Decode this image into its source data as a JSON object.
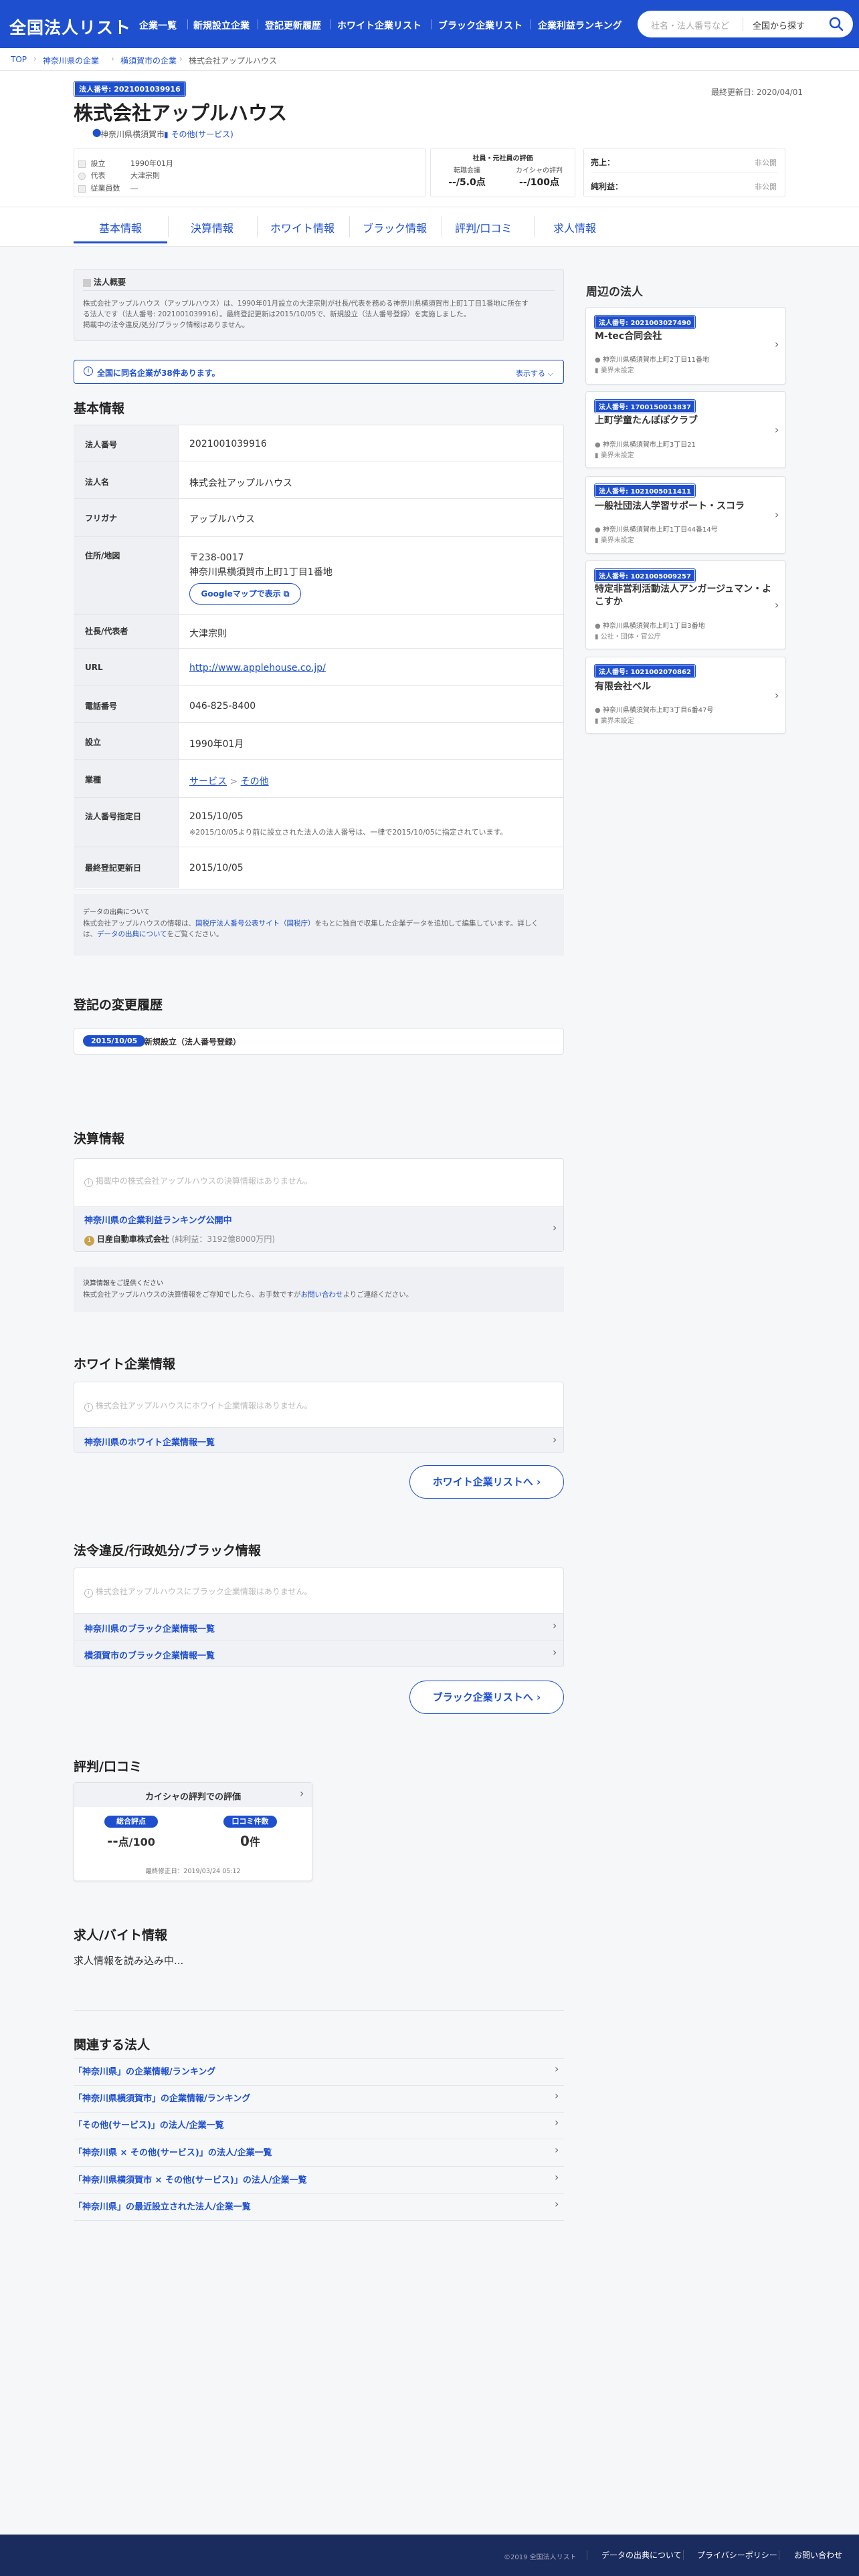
{
  "site": {
    "logo": "全国法人リスト"
  },
  "nav": [
    "企業一覧",
    "新規設立企業",
    "登記更新履歴",
    "ホワイト企業リスト",
    "ブラック企業リスト",
    "企業利益ランキング"
  ],
  "search": {
    "placeholder": "社名・法人番号など",
    "scope": "全国から探す"
  },
  "breadcrumb": [
    "TOP",
    "神奈川県の企業",
    "横須賀市の企業",
    "株式会社アップルハウス"
  ],
  "company": {
    "corp_badge": "法人番号: 2021001039916",
    "name": "株式会社アップルハウス",
    "location": "神奈川県横須賀市",
    "industry": "その他(サービス)",
    "updated": "最終更新日: 2020/04/01",
    "founded_label": "設立",
    "founded": "1990年01月",
    "rep_label": "代表",
    "rep": "大津宗則",
    "emp_label": "従業員数",
    "emp": "―"
  },
  "eval": {
    "title": "社員・元社員の評価",
    "a_label": "転職会議",
    "a_val": "--/5.0点",
    "b_label": "カイシャの評判",
    "b_val": "--/100点"
  },
  "money": {
    "sales_label": "売上：",
    "sales_val": "非公開",
    "profit_label": "純利益：",
    "profit_val": "非公開"
  },
  "tabs": [
    "基本情報",
    "決算情報",
    "ホワイト情報",
    "ブラック情報",
    "評判/口コミ",
    "求人情報"
  ],
  "overview": {
    "title": "法人概要",
    "line1": "株式会社アップルハウス（アップルハウス）は、1990年01月設立の大津宗則が社長/代表を務める神奈川県横須賀市上町1丁目1番地に所在す",
    "line2": "る法人です（法人番号: 2021001039916）。最終登記更新は2015/10/05で、新規設立（法人番号登録）を実施しました。",
    "line3": "掲載中の法令違反/処分/ブラック情報はありません。"
  },
  "samename": {
    "text": "全国に同名企業が38件あります。",
    "more": "表示する"
  },
  "basic": {
    "title": "基本情報",
    "corp_no_label": "法人番号",
    "corp_no": "2021001039916",
    "name_label": "法人名",
    "name": "株式会社アップルハウス",
    "kana_label": "フリガナ",
    "kana": "アップルハウス",
    "addr_label": "住所/地図",
    "zip": "〒238-0017",
    "addr": "神奈川県横須賀市上町1丁目1番地",
    "map_btn": "Googleマップで表示",
    "rep_label": "社長/代表者",
    "rep": "大津宗則",
    "url_label": "URL",
    "url": "http://www.applehouse.co.jp/",
    "tel_label": "電話番号",
    "tel": "046-825-8400",
    "est_label": "設立",
    "est": "1990年01月",
    "ind_label": "業種",
    "ind1": "サービス",
    "ind2": "その他",
    "assign_label": "法人番号指定日",
    "assign": "2015/10/05",
    "assign_note": "※2015/10/05より前に設立された法人の法人番号は、一律で2015/10/05に指定されています。",
    "reg_label": "最終登記更新日",
    "reg": "2015/10/05"
  },
  "source": {
    "title": "データの出典について",
    "l1a": "株式会社アップルハウスの情報は、",
    "l1link": "国税庁法人番号公表サイト（国税庁）",
    "l1b": "をもとに独自で収集した企業データを追加して編集しています。詳しく",
    "l2a": "は、",
    "l2link": "データの出典について",
    "l2b": "をご覧ください。"
  },
  "history": {
    "title": "登記の変更履歴",
    "date": "2015/10/05",
    "event": "新規設立（法人番号登録）"
  },
  "finance": {
    "title": "決算情報",
    "none": "掲載中の株式会社アップルハウスの決算情報はありません。",
    "rank_title": "神奈川県の企業利益ランキング公開中",
    "rank_top": "日産自動車株式会社",
    "rank_profit": "(純利益：3192億8000万円)",
    "req_title": "決算情報をご提供ください",
    "req_a": "株式会社アップルハウスの決算情報をご存知でしたら、お手数ですが",
    "req_link": "お問い合わせ",
    "req_b": "よりご連絡ください。"
  },
  "white": {
    "title": "ホワイト企業情報",
    "none": "株式会社アップルハウスにホワイト企業情報はありません。",
    "link": "神奈川県のホワイト企業情報一覧",
    "btn": "ホワイト企業リストへ"
  },
  "black": {
    "title": "法令違反/行政処分/ブラック情報",
    "none": "株式会社アップルハウスにブラック企業情報はありません。",
    "link1": "神奈川県のブラック企業情報一覧",
    "link2": "横須賀市のブラック企業情報一覧",
    "btn": "ブラック企業リストへ"
  },
  "review": {
    "title": "評判/口コミ",
    "card_title": "カイシャの評判での評価",
    "score_label": "総合評点",
    "score_val": "--",
    "score_unit": "点/100",
    "count_label": "口コミ件数",
    "count_val": "0",
    "count_unit": "件",
    "updated": "最終修正日：2019/03/24 05:12"
  },
  "jobs": {
    "title": "求人/バイト情報",
    "loading": "求人情報を読み込み中..."
  },
  "related": {
    "title": "関連する法人",
    "items": [
      "「神奈川県」の企業情報/ランキング",
      "「神奈川県横須賀市」の企業情報/ランキング",
      "「その他(サービス)」の法人/企業一覧",
      "「神奈川県 × その他(サービス)」の法人/企業一覧",
      "「神奈川県横須賀市 × その他(サービス)」の法人/企業一覧",
      "「神奈川県」の最近設立された法人/企業一覧"
    ]
  },
  "nearby": {
    "title": "周辺の法人",
    "items": [
      {
        "badge": "法人番号: 2021003027490",
        "name": "M-tec合同会社",
        "addr": "神奈川県横須賀市上町2丁目11番地",
        "cat": "業界未設定"
      },
      {
        "badge": "法人番号: 1700150013837",
        "name": "上町学童たんぽぽクラブ",
        "addr": "神奈川県横須賀市上町3丁目21",
        "cat": "業界未設定"
      },
      {
        "badge": "法人番号: 1021005011411",
        "name": "一般社団法人学習サポート・スコラ",
        "addr": "神奈川県横須賀市上町1丁目44番14号",
        "cat": "業界未設定"
      },
      {
        "badge": "法人番号: 1021005009257",
        "name": "特定非営利活動法人アンガージュマン・よこすか",
        "addr": "神奈川県横須賀市上町1丁目3番地",
        "cat": "公社・団体・官公庁"
      },
      {
        "badge": "法人番号: 1021002070862",
        "name": "有限会社ベル",
        "addr": "神奈川県横須賀市上町3丁目6番47号",
        "cat": "業界未設定"
      }
    ]
  },
  "footer": {
    "copy": "©2019 全国法人リスト",
    "links": [
      "データの出典について",
      "プライバシーポリシー",
      "お問い合わせ"
    ]
  }
}
